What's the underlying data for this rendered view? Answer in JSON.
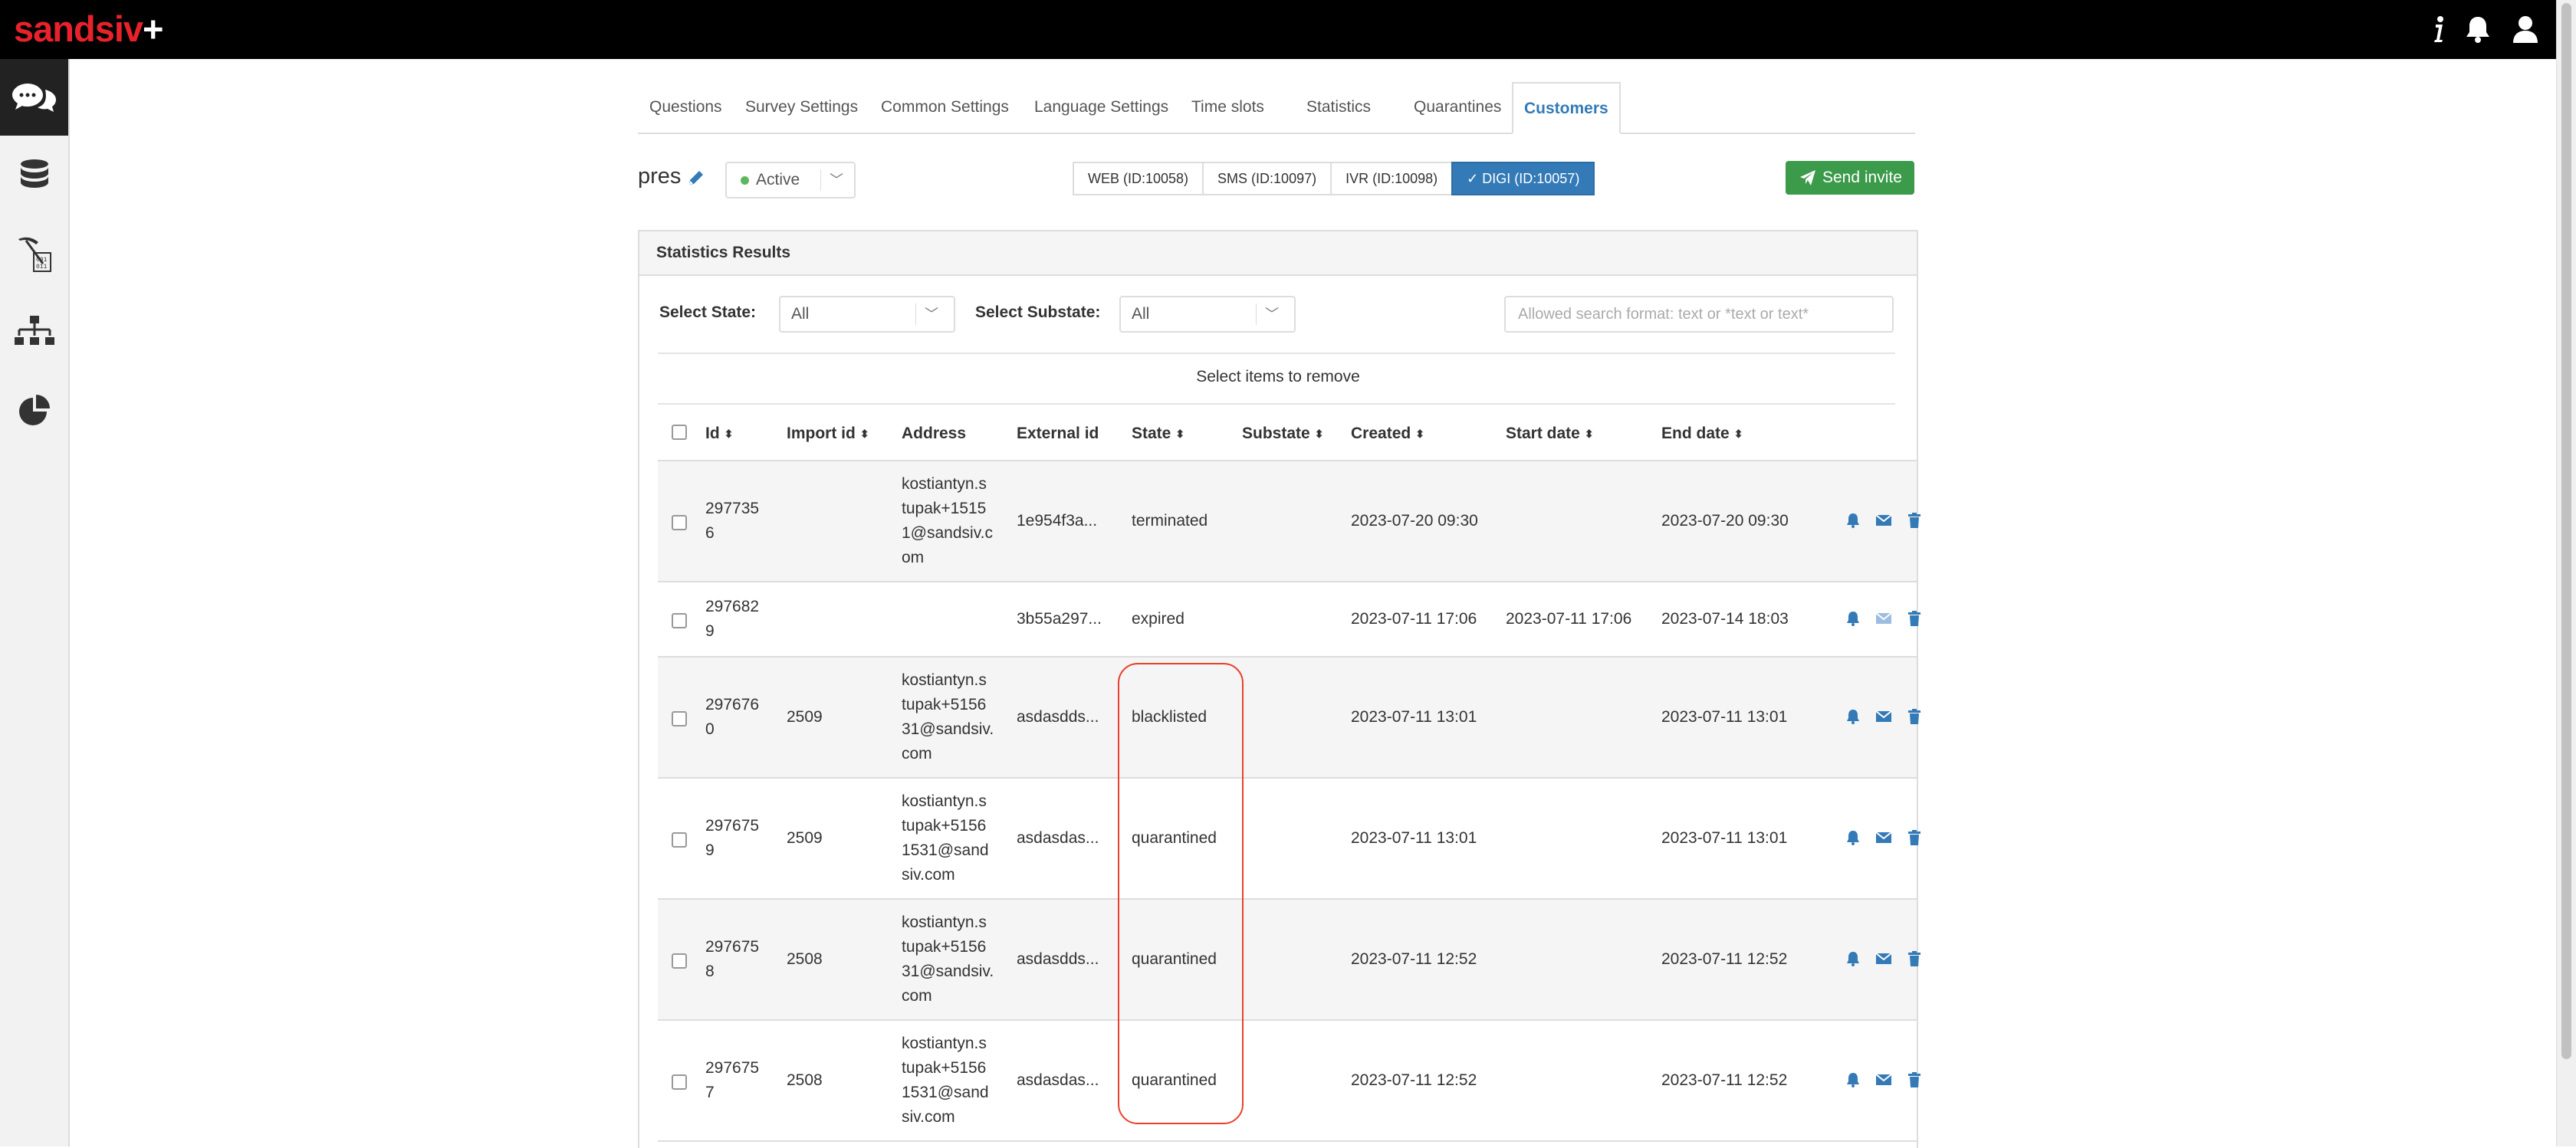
{
  "app": {
    "logo": "sandsiv",
    "logo_plus": "+"
  },
  "tabs": [
    {
      "label": "Questions"
    },
    {
      "label": "Survey Settings"
    },
    {
      "label": "Common Settings"
    },
    {
      "label": "Language Settings"
    },
    {
      "label": "Time slots"
    },
    {
      "label": "Statistics"
    },
    {
      "label": "Quarantines"
    },
    {
      "label": "Customers"
    }
  ],
  "survey": {
    "name": "pres",
    "status": "Active"
  },
  "channels": [
    {
      "label": "WEB (ID:10058)"
    },
    {
      "label": "SMS (ID:10097)"
    },
    {
      "label": "IVR (ID:10098)"
    },
    {
      "label": "DIGI (ID:10057)"
    }
  ],
  "send_invite": "Send invite",
  "panel": {
    "title": "Statistics Results",
    "state_label": "Select State:",
    "state_value": "All",
    "substate_label": "Select Substate:",
    "substate_value": "All",
    "search_placeholder": "Allowed search format: text or *text or text*",
    "remove_text": "Select items to remove"
  },
  "columns": {
    "id": "Id",
    "import_id": "Import id",
    "address": "Address",
    "external_id": "External id",
    "state": "State",
    "substate": "Substate",
    "created": "Created",
    "start_date": "Start date",
    "end_date": "End date"
  },
  "rows": [
    {
      "id1": "297735",
      "id2": "6",
      "import_id": "",
      "address": [
        "kostiantyn.s",
        "tupak+1515",
        "1@sandsiv.c",
        "om"
      ],
      "external_id": "1e954f3a...",
      "state": "terminated",
      "substate": "",
      "created": "2023-07-20 09:30",
      "start_date": "",
      "end_date": "2023-07-20 09:30"
    },
    {
      "id1": "297682",
      "id2": "9",
      "import_id": "",
      "address": [],
      "external_id": "3b55a297...",
      "state": "expired",
      "substate": "",
      "created": "2023-07-11 17:06",
      "start_date": "2023-07-11 17:06",
      "end_date": "2023-07-14 18:03"
    },
    {
      "id1": "297676",
      "id2": "0",
      "import_id": "2509",
      "address": [
        "kostiantyn.s",
        "tupak+5156",
        "31@sandsiv.",
        "com"
      ],
      "external_id": "asdasdds...",
      "state": "blacklisted",
      "substate": "",
      "created": "2023-07-11 13:01",
      "start_date": "",
      "end_date": "2023-07-11 13:01"
    },
    {
      "id1": "297675",
      "id2": "9",
      "import_id": "2509",
      "address": [
        "kostiantyn.s",
        "tupak+5156",
        "1531@sand",
        "siv.com"
      ],
      "external_id": "asdasdas...",
      "state": "quarantined",
      "substate": "",
      "created": "2023-07-11 13:01",
      "start_date": "",
      "end_date": "2023-07-11 13:01"
    },
    {
      "id1": "297675",
      "id2": "8",
      "import_id": "2508",
      "address": [
        "kostiantyn.s",
        "tupak+5156",
        "31@sandsiv.",
        "com"
      ],
      "external_id": "asdasdds...",
      "state": "quarantined",
      "substate": "",
      "created": "2023-07-11 12:52",
      "start_date": "",
      "end_date": "2023-07-11 12:52"
    },
    {
      "id1": "297675",
      "id2": "7",
      "import_id": "2508",
      "address": [
        "kostiantyn.s",
        "tupak+5156",
        "1531@sand",
        "siv.com"
      ],
      "external_id": "asdasdas...",
      "state": "quarantined",
      "substate": "",
      "created": "2023-07-11 12:52",
      "start_date": "",
      "end_date": "2023-07-11 12:52"
    }
  ],
  "colors": {
    "accent": "#337ab7",
    "green": "#3c9a4b",
    "brand": "#e8222b",
    "highlight": "#e8412c"
  }
}
